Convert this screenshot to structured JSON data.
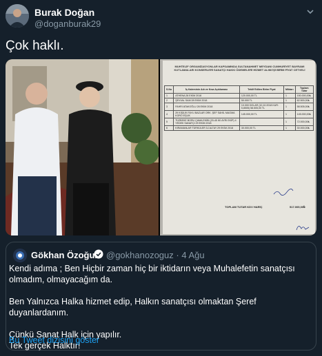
{
  "author": {
    "name": "Burak Doğan",
    "handle": "@doganburak29"
  },
  "tweet": {
    "text": "Çok haklı."
  },
  "document": {
    "header": "MUHTELİF ORGANİZASYONLAR KAPSAMINDA SULTANAHMET MEYDANI CUMHURİYET BAYRAMI KUTLAMALARI KONSERLERİ SANATÇI HAKKI ÖDEMELERİ HİZMET ALIMI İŞİ BİRİM FİYAT CETVELİ",
    "columns": [
      "S.No",
      "İş Kaleminin Adı ve Kısa Açıklaması",
      "Teklif Edilen Birim Fiyat",
      "Miktarı",
      "Toplam Tutar"
    ],
    "rows": [
      [
        "1",
        "ATHENA 28 EKİM 2018",
        "120.000,00 TL",
        "1",
        "150.000,00₺"
      ],
      [
        "2",
        "ŞEVVAL SAM 28 EKİM 2018",
        "50.000 TL",
        "1",
        "62.500,00₺"
      ],
      [
        "3",
        "FAHRİ ATAKOĞLU 28 EKİM 2018",
        "10.000 DOLAR (10,10.2018 KUR: 5,8505) 58.505,00 TL",
        "1",
        "58.505,00₺"
      ],
      [
        "4",
        "29 KİŞİLİK FAYLI BAZLAR ORK. ŞEF SAHİL MAGMA KORO EŞLİK",
        "145.000,00 TL",
        "1",
        "145.000,00₺"
      ],
      [
        "5",
        "TÜZBEKE BORU ÇAMA EKİBİ (20-45 İKİ AYRI EKİP) 4 YEDEK SANATÇI 29 EKİM 2018",
        "",
        "1",
        "72.000,00₺"
      ],
      [
        "6",
        "KIRAMANLAR TÜRKÜLER İLİ ALTAY 29 EKİM 2018",
        "30.000,00 TL",
        "1",
        "30.000,00₺"
      ]
    ],
    "total_label": "TOPLAM TUTAR  KDV HARİÇ",
    "total_value": "517.005,00₺"
  },
  "quoted_tweet": {
    "name": "Gökhan Özoğuz",
    "handle": "@gokhanozoguz",
    "time": "· 4 Ağu",
    "lines": [
      "Kendi adıma ; Ben Hiçbir zaman hiç bir iktidarın veya Muhalefetin sanatçısı olmadım, olmayacağım da.",
      "Ben Yalnızca Halka hizmet edip, Halkın sanatçısı olmaktan Şeref duyanlardanım.",
      "Çünkü Sanat Halk için yapılır.",
      "Tek gerçek Halktır!"
    ],
    "thread_link": "Bu Tweet dizisini göster"
  },
  "colors": {
    "background": "#15202b",
    "secondary_text": "#8899a6",
    "accent": "#1da1f2",
    "border": "#38444d"
  },
  "icons": {
    "caret": "chevron-down-icon",
    "verified": "verified-badge-icon"
  }
}
